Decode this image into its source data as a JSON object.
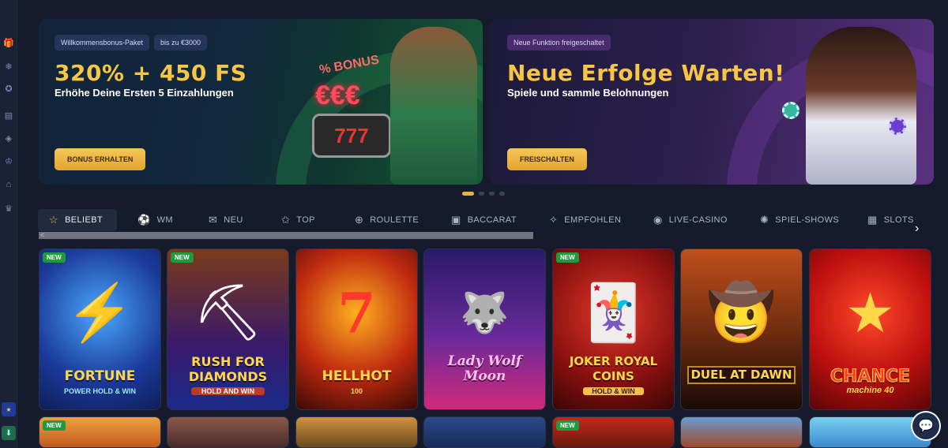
{
  "rail_icons": [
    "gift-icon",
    "snowflake-icon",
    "badge-icon",
    "card-icon",
    "diamond-icon",
    "trophy-icon",
    "basket-icon",
    "crown-icon"
  ],
  "banners": [
    {
      "tag1": "Willkommensbonus-Paket",
      "tag2": "bis zu €3000",
      "headline": "320% + 450 FS",
      "sub": "Erhöhe Deine Ersten 5 Einzahlungen",
      "button": "BONUS ERHALTEN",
      "art_text_a": "% BONUS",
      "art_text_b": "€€€",
      "art_text_c": "777"
    },
    {
      "tag1": "Neue Funktion freigeschaltet",
      "headline": "Neue Erfolge Warten!",
      "sub": "Spiele und sammle Belohnungen",
      "button": "FREISCHALTEN"
    }
  ],
  "tabs": [
    {
      "label": "BELIEBT",
      "icon": "star-icon"
    },
    {
      "label": "WM",
      "icon": "ball-icon"
    },
    {
      "label": "NEU",
      "icon": "ticket-icon"
    },
    {
      "label": "TOP",
      "icon": "star-outline-icon"
    },
    {
      "label": "ROULETTE",
      "icon": "roulette-icon"
    },
    {
      "label": "BACCARAT",
      "icon": "cards-icon"
    },
    {
      "label": "EMPFOHLEN",
      "icon": "thumb-icon"
    },
    {
      "label": "LIVE-CASINO",
      "icon": "chip-icon"
    },
    {
      "label": "SPIEL-SHOWS",
      "icon": "wheel-icon"
    },
    {
      "label": "SLOTS",
      "icon": "slot-icon"
    }
  ],
  "scroll_left": "<",
  "next_arrow": "›",
  "new_badge": "NEW",
  "games": [
    {
      "title": "FORTUNE",
      "sub": "POWER HOLD & WIN",
      "new": true
    },
    {
      "title": "RUSH FOR DIAMONDS",
      "sub": "HOLD AND WIN",
      "new": true
    },
    {
      "title": "HELLHOT",
      "sub": "100",
      "new": false
    },
    {
      "title": "Lady Wolf Moon",
      "sub": "",
      "new": false
    },
    {
      "title": "JOKER ROYAL COINS",
      "sub": "HOLD & WIN",
      "new": true
    },
    {
      "title": "DUEL AT DAWN",
      "sub": "",
      "new": false
    },
    {
      "title": "CHANCE",
      "sub": "machine 40",
      "new": false
    }
  ],
  "row2_new": [
    true,
    false,
    false,
    false,
    true,
    false,
    false
  ]
}
